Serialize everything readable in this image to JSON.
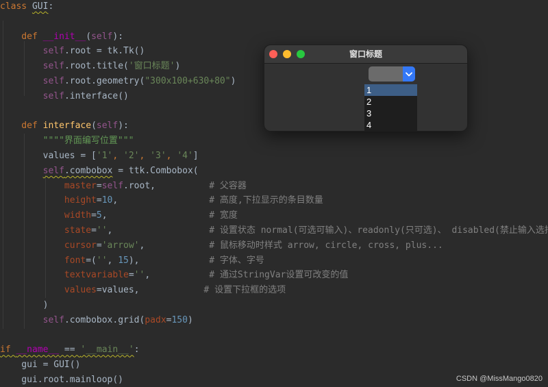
{
  "code": {
    "lines": [
      [
        {
          "t": "class ",
          "c": "kw"
        },
        {
          "t": "GUI",
          "c": "cls squiggle"
        },
        {
          "t": ":",
          "c": ""
        }
      ],
      [],
      [
        {
          "t": "    def ",
          "c": "kw"
        },
        {
          "t": "__init__",
          "c": "dunder"
        },
        {
          "t": "(",
          "c": ""
        },
        {
          "t": "self",
          "c": "self"
        },
        {
          "t": "):",
          "c": ""
        }
      ],
      [
        {
          "t": "        ",
          "c": ""
        },
        {
          "t": "self",
          "c": "self"
        },
        {
          "t": ".root = tk.Tk()",
          "c": ""
        }
      ],
      [
        {
          "t": "        ",
          "c": ""
        },
        {
          "t": "self",
          "c": "self"
        },
        {
          "t": ".root.title(",
          "c": ""
        },
        {
          "t": "'窗口标题'",
          "c": "str"
        },
        {
          "t": ")",
          "c": ""
        }
      ],
      [
        {
          "t": "        ",
          "c": ""
        },
        {
          "t": "self",
          "c": "self"
        },
        {
          "t": ".root.geometry(",
          "c": ""
        },
        {
          "t": "\"300x100+630+80\"",
          "c": "str"
        },
        {
          "t": ")",
          "c": ""
        }
      ],
      [
        {
          "t": "        ",
          "c": ""
        },
        {
          "t": "self",
          "c": "self"
        },
        {
          "t": ".interface()",
          "c": ""
        }
      ],
      [],
      [
        {
          "t": "    def ",
          "c": "kw"
        },
        {
          "t": "interface",
          "c": "fn"
        },
        {
          "t": "(",
          "c": ""
        },
        {
          "t": "self",
          "c": "self"
        },
        {
          "t": "):",
          "c": ""
        }
      ],
      [
        {
          "t": "        ",
          "c": ""
        },
        {
          "t": "\"\"\"\"界面编写位置\"\"\"",
          "c": "doc"
        }
      ],
      [
        {
          "t": "        values = [",
          "c": ""
        },
        {
          "t": "'1'",
          "c": "str"
        },
        {
          "t": ", ",
          "c": "kw"
        },
        {
          "t": "'2'",
          "c": "str"
        },
        {
          "t": ", ",
          "c": "kw"
        },
        {
          "t": "'3'",
          "c": "str"
        },
        {
          "t": ", ",
          "c": "kw"
        },
        {
          "t": "'4'",
          "c": "str"
        },
        {
          "t": "]",
          "c": ""
        }
      ],
      [
        {
          "t": "        ",
          "c": ""
        },
        {
          "t": "self",
          "c": "self squiggle"
        },
        {
          "t": ".combobox",
          "c": "squiggle"
        },
        {
          "t": " = ttk.Combobox(",
          "c": ""
        }
      ],
      [
        {
          "t": "            ",
          "c": ""
        },
        {
          "t": "master",
          "c": "param"
        },
        {
          "t": "=",
          "c": ""
        },
        {
          "t": "self",
          "c": "self"
        },
        {
          "t": ".root,",
          "c": ""
        },
        {
          "t": "          # 父容器",
          "c": "cmt"
        }
      ],
      [
        {
          "t": "            ",
          "c": ""
        },
        {
          "t": "height",
          "c": "param"
        },
        {
          "t": "=",
          "c": ""
        },
        {
          "t": "10",
          "c": "num"
        },
        {
          "t": ",",
          "c": ""
        },
        {
          "t": "                 # 高度,下拉显示的条目数量",
          "c": "cmt"
        }
      ],
      [
        {
          "t": "            ",
          "c": ""
        },
        {
          "t": "width",
          "c": "param"
        },
        {
          "t": "=",
          "c": ""
        },
        {
          "t": "5",
          "c": "num"
        },
        {
          "t": ",",
          "c": ""
        },
        {
          "t": "                   # 宽度",
          "c": "cmt"
        }
      ],
      [
        {
          "t": "            ",
          "c": ""
        },
        {
          "t": "state",
          "c": "param"
        },
        {
          "t": "=",
          "c": ""
        },
        {
          "t": "''",
          "c": "str"
        },
        {
          "t": ",",
          "c": ""
        },
        {
          "t": "                  # 设置状态 normal(可选可输入)、readonly(只可选)、 disabled(禁止输入选择)",
          "c": "cmt"
        }
      ],
      [
        {
          "t": "            ",
          "c": ""
        },
        {
          "t": "cursor",
          "c": "param"
        },
        {
          "t": "=",
          "c": ""
        },
        {
          "t": "'arrow'",
          "c": "str"
        },
        {
          "t": ",",
          "c": ""
        },
        {
          "t": "            # 鼠标移动时样式 arrow, circle, cross, plus...",
          "c": "cmt"
        }
      ],
      [
        {
          "t": "            ",
          "c": ""
        },
        {
          "t": "font",
          "c": "param"
        },
        {
          "t": "=(",
          "c": ""
        },
        {
          "t": "''",
          "c": "str"
        },
        {
          "t": ", ",
          "c": ""
        },
        {
          "t": "15",
          "c": "num"
        },
        {
          "t": "),",
          "c": ""
        },
        {
          "t": "             # 字体、字号",
          "c": "cmt"
        }
      ],
      [
        {
          "t": "            ",
          "c": ""
        },
        {
          "t": "textvariable",
          "c": "param"
        },
        {
          "t": "=",
          "c": ""
        },
        {
          "t": "''",
          "c": "str"
        },
        {
          "t": ",",
          "c": ""
        },
        {
          "t": "           # 通过StringVar设置可改变的值",
          "c": "cmt"
        }
      ],
      [
        {
          "t": "            ",
          "c": ""
        },
        {
          "t": "values",
          "c": "param"
        },
        {
          "t": "=values,",
          "c": ""
        },
        {
          "t": "            # 设置下拉框的选项",
          "c": "cmt"
        }
      ],
      [
        {
          "t": "        )",
          "c": ""
        }
      ],
      [
        {
          "t": "        ",
          "c": ""
        },
        {
          "t": "self",
          "c": "self"
        },
        {
          "t": ".combobox.grid(",
          "c": ""
        },
        {
          "t": "padx",
          "c": "param"
        },
        {
          "t": "=",
          "c": ""
        },
        {
          "t": "150",
          "c": "num"
        },
        {
          "t": ")",
          "c": ""
        }
      ],
      [],
      [
        {
          "t": "if ",
          "c": "kw squiggle"
        },
        {
          "t": "__name__",
          "c": "dunder squiggle"
        },
        {
          "t": " == ",
          "c": "squiggle"
        },
        {
          "t": "'__main__'",
          "c": "str squiggle"
        },
        {
          "t": ":",
          "c": ""
        }
      ],
      [
        {
          "t": "    gui = GUI()",
          "c": ""
        }
      ],
      [
        {
          "t": "    gui.root.mainloop()",
          "c": ""
        }
      ]
    ]
  },
  "window": {
    "title": "窗口标题",
    "combobox": {
      "value": "",
      "options": [
        "1",
        "2",
        "3",
        "4"
      ],
      "selected_index": 0,
      "button_color": "#3478f6"
    }
  },
  "watermark": "CSDN @MissMango0820"
}
